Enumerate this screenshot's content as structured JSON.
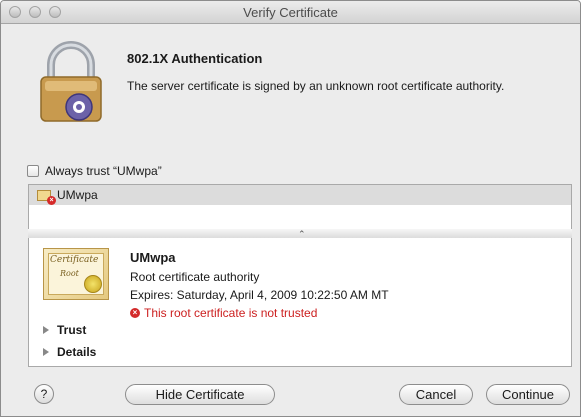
{
  "window": {
    "title": "Verify Certificate"
  },
  "header": {
    "heading": "802.1X Authentication",
    "message": "The server certificate is signed by an unknown root certificate authority."
  },
  "trust_option": {
    "label": "Always trust “UMwpa”",
    "checked": false
  },
  "cert_list": {
    "items": [
      {
        "label": "UMwpa"
      }
    ]
  },
  "certificate": {
    "art_title": "Certificate",
    "art_subtitle": "Root",
    "name": "UMwpa",
    "kind": "Root certificate authority",
    "expires": "Expires: Saturday, April 4, 2009 10:22:50 AM MT",
    "warning": "This root certificate is not trusted"
  },
  "sections": {
    "trust": "Trust",
    "details": "Details"
  },
  "buttons": {
    "help": "?",
    "hide_certificate": "Hide Certificate",
    "cancel": "Cancel",
    "continue": "Continue"
  },
  "colors": {
    "warning": "#cc1f1f",
    "selection": "#dcdcdc"
  },
  "icons": {
    "lock": "padlock-icon",
    "cert": "certificate-icon",
    "warn": "error-x-icon"
  }
}
